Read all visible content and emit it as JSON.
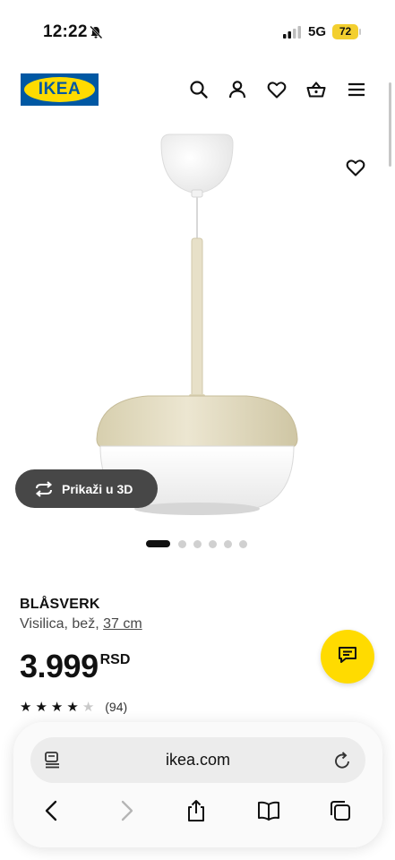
{
  "status": {
    "time": "12:22",
    "network": "5G",
    "battery": "72"
  },
  "header": {
    "logo_text": "IKEA"
  },
  "gallery": {
    "view_3d_label": "Prikaži u 3D",
    "dots_total": 6,
    "active_index": 0
  },
  "product": {
    "name": "BLÅSVERK",
    "description": "Visilica, bež,",
    "size": "37 cm",
    "price": "3.999",
    "currency": "RSD",
    "rating": 4.5,
    "rating_max": 5,
    "review_count": "(94)"
  },
  "browser": {
    "url": "ikea.com"
  },
  "colors": {
    "ikea_blue": "#0058a3",
    "ikea_yellow": "#ffdb00",
    "battery_yellow": "#f3cf2f"
  }
}
